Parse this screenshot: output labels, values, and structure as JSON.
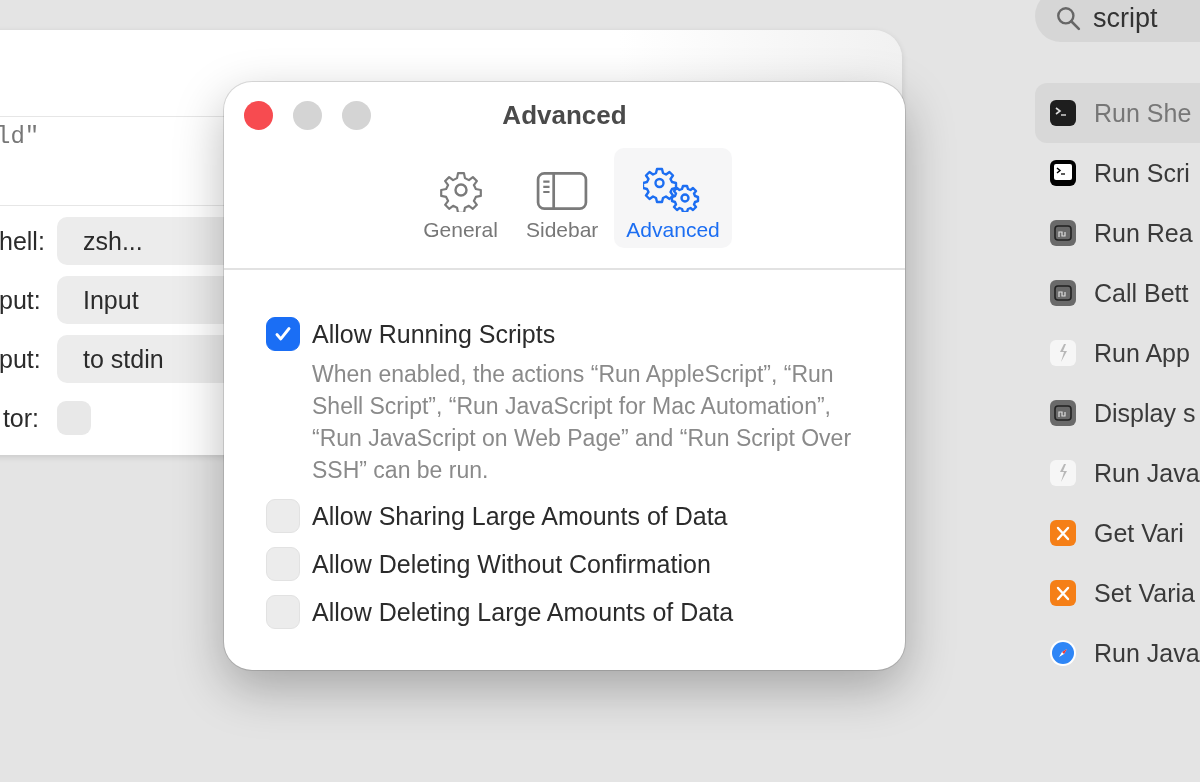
{
  "back_window": {
    "script_tail": "ld\"",
    "rows": [
      {
        "label": "hell:",
        "kind": "popup",
        "value": "zsh..."
      },
      {
        "label": "put:",
        "kind": "popup",
        "value": "Input"
      },
      {
        "label": "put:",
        "kind": "popup",
        "value": "to stdin"
      },
      {
        "label": "tor:",
        "kind": "checkbox",
        "checked": false
      }
    ]
  },
  "dialog": {
    "title": "Advanced",
    "tabs": [
      {
        "label": "General",
        "kind": "gear",
        "selected": false
      },
      {
        "label": "Sidebar",
        "kind": "sidebar",
        "selected": false
      },
      {
        "label": "Advanced",
        "kind": "gears",
        "selected": true
      }
    ],
    "options": [
      {
        "label": "Allow Running Scripts",
        "checked": true,
        "description": "When enabled, the actions “Run AppleScript”, “Run Shell Script”, “Run JavaScript for Mac Automation”, “Run JavaScript on Web Page” and “Run Script Over SSH” can be run."
      },
      {
        "label": "Allow Sharing Large Amounts of Data",
        "checked": false
      },
      {
        "label": "Allow Deleting Without Confirmation",
        "checked": false
      },
      {
        "label": "Allow Deleting Large Amounts of Data",
        "checked": false
      }
    ]
  },
  "action_search": {
    "value": "script"
  },
  "actions": [
    {
      "label": "Run She",
      "kind": "terminal-dark",
      "selected": true
    },
    {
      "label": "Run Scri",
      "kind": "terminal",
      "selected": false
    },
    {
      "label": "Run Rea",
      "kind": "app",
      "selected": false
    },
    {
      "label": "Call Bett",
      "kind": "app",
      "selected": false
    },
    {
      "label": "Run App",
      "kind": "script",
      "selected": false
    },
    {
      "label": "Display s",
      "kind": "app",
      "selected": false
    },
    {
      "label": "Run Java",
      "kind": "script",
      "selected": false
    },
    {
      "label": "Get Vari",
      "kind": "variable",
      "selected": false
    },
    {
      "label": "Set Varia",
      "kind": "variable",
      "selected": false
    },
    {
      "label": "Run Java",
      "kind": "compass",
      "selected": false
    }
  ]
}
